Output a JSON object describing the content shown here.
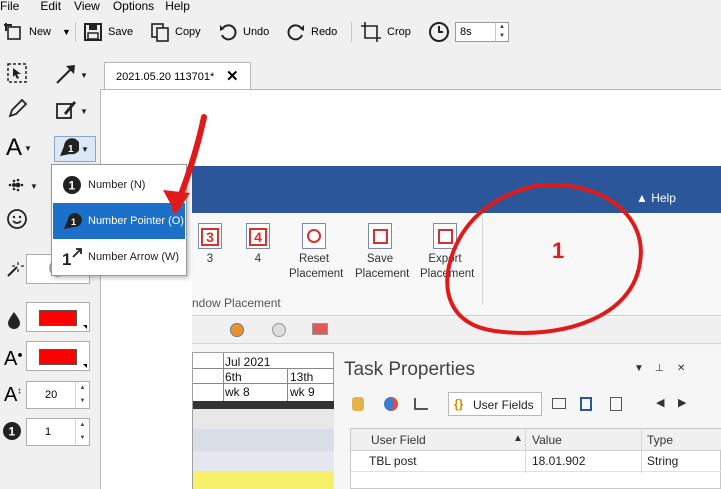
{
  "menu": [
    "File",
    "Edit",
    "View",
    "Options",
    "Help"
  ],
  "toolbar": {
    "new_label": "New",
    "save_label": "Save",
    "copy_label": "Copy",
    "undo_label": "Undo",
    "redo_label": "Redo",
    "crop_label": "Crop",
    "delay_value": "8s"
  },
  "left_panel": {
    "font_size_value": "20",
    "number_value": "1",
    "fill_color": "#ff0000",
    "text_color": "#ff0000"
  },
  "number_menu": {
    "items": [
      {
        "label": "Number (N)",
        "icon": "number-icon"
      },
      {
        "label": "Number Pointer (O)",
        "icon": "number-pointer-icon"
      },
      {
        "label": "Number Arrow (W)",
        "icon": "number-arrow-icon"
      }
    ]
  },
  "document_tab": {
    "title": "2021.05.20 113701*"
  },
  "captured_image": {
    "help_label": "Help",
    "ribbon_buttons": [
      {
        "icon_text": "3",
        "label": "3"
      },
      {
        "icon_text": "4",
        "label": "4"
      },
      {
        "label": "Reset Placement"
      },
      {
        "label": "Save Placement"
      },
      {
        "label": "Export Placement"
      }
    ],
    "group_label": "ndow Placement",
    "gantt": {
      "month": "Jul 2021",
      "day1": "6th",
      "day2": "13th",
      "week1": "wk 8",
      "week2": "wk 9"
    },
    "task_properties": {
      "title": "Task Properties",
      "active_tab": "User Fields",
      "columns": [
        "User Field",
        "Value",
        "Type"
      ],
      "row": {
        "field": "TBL post",
        "value": "18.01.902",
        "type": "String"
      }
    }
  },
  "annotation": {
    "number_label": "1",
    "color": "#e01a1a"
  }
}
